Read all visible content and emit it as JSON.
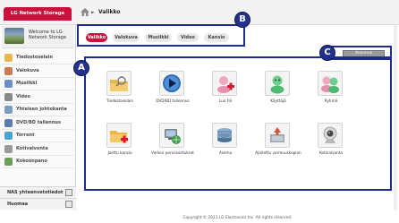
{
  "header": {
    "logo_text": "LG Network Storage",
    "breadcrumb": "Valikko",
    "breadcrumb_arrow": "►"
  },
  "sidebar": {
    "welcome_text": "Welcome to LG\nNetwork Storage",
    "items": [
      {
        "label": "Tiedostoselain",
        "icon": "folder-icon",
        "color": "#e6b850"
      },
      {
        "label": "Valokuva",
        "icon": "photo-icon",
        "color": "#d07a55"
      },
      {
        "label": "Musiikki",
        "icon": "music-icon",
        "color": "#6a8fc7"
      },
      {
        "label": "Video",
        "icon": "video-icon",
        "color": "#8a8a8a"
      },
      {
        "label": "Yhteisen johtokanta",
        "icon": "shared-db-icon",
        "color": "#7c9bbf"
      },
      {
        "label": "DVD/BD tallennus",
        "icon": "disc-icon",
        "color": "#5b7bb3"
      },
      {
        "label": "Torrent",
        "icon": "torrent-icon",
        "color": "#4aa3d6"
      },
      {
        "label": "Kotivalvonta",
        "icon": "camera-icon",
        "color": "#9a9a9a"
      },
      {
        "label": "Kokoonpano",
        "icon": "settings-icon",
        "color": "#6d9f5a"
      }
    ],
    "bottom_items": [
      {
        "label": "NAS yhteenvetotiedot"
      },
      {
        "label": "Huomaa"
      }
    ]
  },
  "tabs": [
    {
      "label": "Valikko",
      "active": true
    },
    {
      "label": "Valokuva",
      "active": false
    },
    {
      "label": "Musiikki",
      "active": false
    },
    {
      "label": "Video",
      "active": false
    },
    {
      "label": "Kansio",
      "active": false
    }
  ],
  "markers": {
    "a": "A",
    "b": "B",
    "c": "C"
  },
  "admin_button": "Asennus",
  "apps": [
    {
      "label": "Tiedostoselain",
      "icon": "folder-search-icon"
    },
    {
      "label": "DVD/BD tallennus",
      "icon": "dvd-play-icon"
    },
    {
      "label": "Luo tili",
      "icon": "add-user-icon"
    },
    {
      "label": "Käyttäjä",
      "icon": "user-icon"
    },
    {
      "label": "Ryhmä",
      "icon": "group-icon"
    },
    {
      "label": "Jaettu kansio",
      "icon": "add-folder-icon"
    },
    {
      "label": "Verkon perusasetukset",
      "icon": "network-icon"
    },
    {
      "label": "Asema",
      "icon": "drive-icon"
    },
    {
      "label": "Ajoitettu varmuuskopion",
      "icon": "backup-icon"
    },
    {
      "label": "Kotivalvonta",
      "icon": "webcam-icon"
    }
  ],
  "footer": "Copyright © 2011 LG Electronics Inc. All rights reserved."
}
